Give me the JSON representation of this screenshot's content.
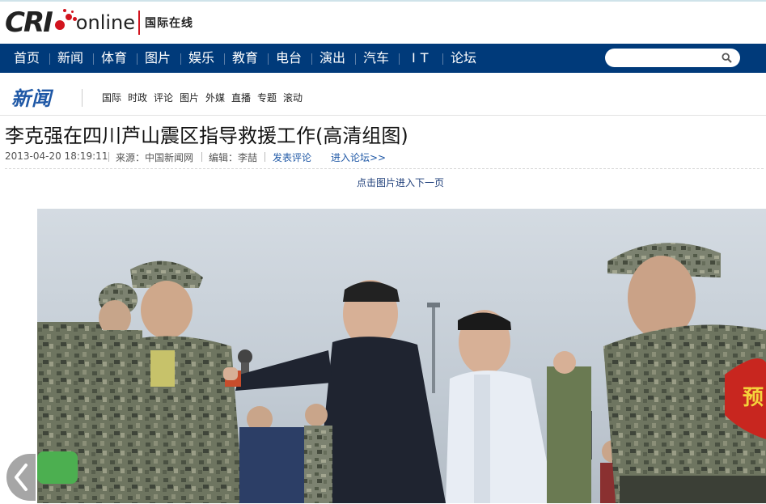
{
  "logo": {
    "brand": "CRI",
    "online": "online",
    "tagline": "国际在线"
  },
  "nav": {
    "items": [
      "首页",
      "新闻",
      "体育",
      "图片",
      "娱乐",
      "教育",
      "电台",
      "演出",
      "汽车",
      "IT",
      "论坛"
    ],
    "search_placeholder": ""
  },
  "section": {
    "title": "新闻",
    "links": [
      "国际",
      "时政",
      "评论",
      "图片",
      "外媒",
      "直播",
      "专题",
      "滚动"
    ]
  },
  "article": {
    "headline": "李克强在四川芦山震区指导救援工作(高清组图)",
    "datetime": "2013-04-20 18:19:11",
    "source": "来源：中国新闻网",
    "editor": "编辑：李喆",
    "comment_link": "发表评论",
    "forum_link": "进入论坛>>",
    "next_page_hint": "点击图片进入下一页"
  },
  "colors": {
    "nav_bg": "#003a7a",
    "section_title": "#1f58a6",
    "logo_red": "#d2141e"
  },
  "icons": {
    "search": "magnifier",
    "prev": "chevron-left"
  }
}
